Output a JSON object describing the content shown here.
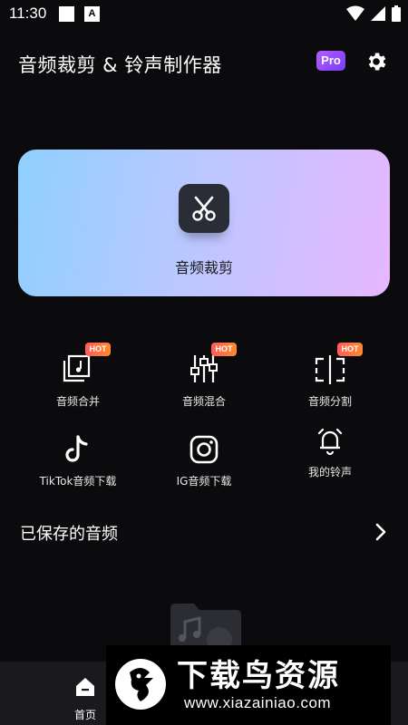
{
  "status_bar": {
    "time": "11:30",
    "badge_letter": "A"
  },
  "header": {
    "title": "音频裁剪 & 铃声制作器",
    "pro_label": "Pro"
  },
  "banner": {
    "label": "音频裁剪"
  },
  "tools": [
    {
      "label": "音频合并",
      "icon": "audio-merge-icon",
      "badge": "HOT"
    },
    {
      "label": "音频混合",
      "icon": "audio-mix-icon",
      "badge": "HOT"
    },
    {
      "label": "音频分割",
      "icon": "audio-split-icon",
      "badge": "HOT"
    },
    {
      "label": "TikTok音频下载",
      "icon": "tiktok-icon"
    },
    {
      "label": "IG音频下载",
      "icon": "instagram-icon"
    },
    {
      "label": "我的铃声",
      "icon": "bell-icon"
    }
  ],
  "saved": {
    "title": "已保存的音频"
  },
  "bottom_nav": {
    "home_label": "首页"
  },
  "watermark": {
    "text": "下载鸟资源",
    "url": "www.xiazainiao.com"
  },
  "colors": {
    "background": "#0b0b0d",
    "hot_badge": "#ff6a3a",
    "pro_badge": "#9b4dff"
  }
}
